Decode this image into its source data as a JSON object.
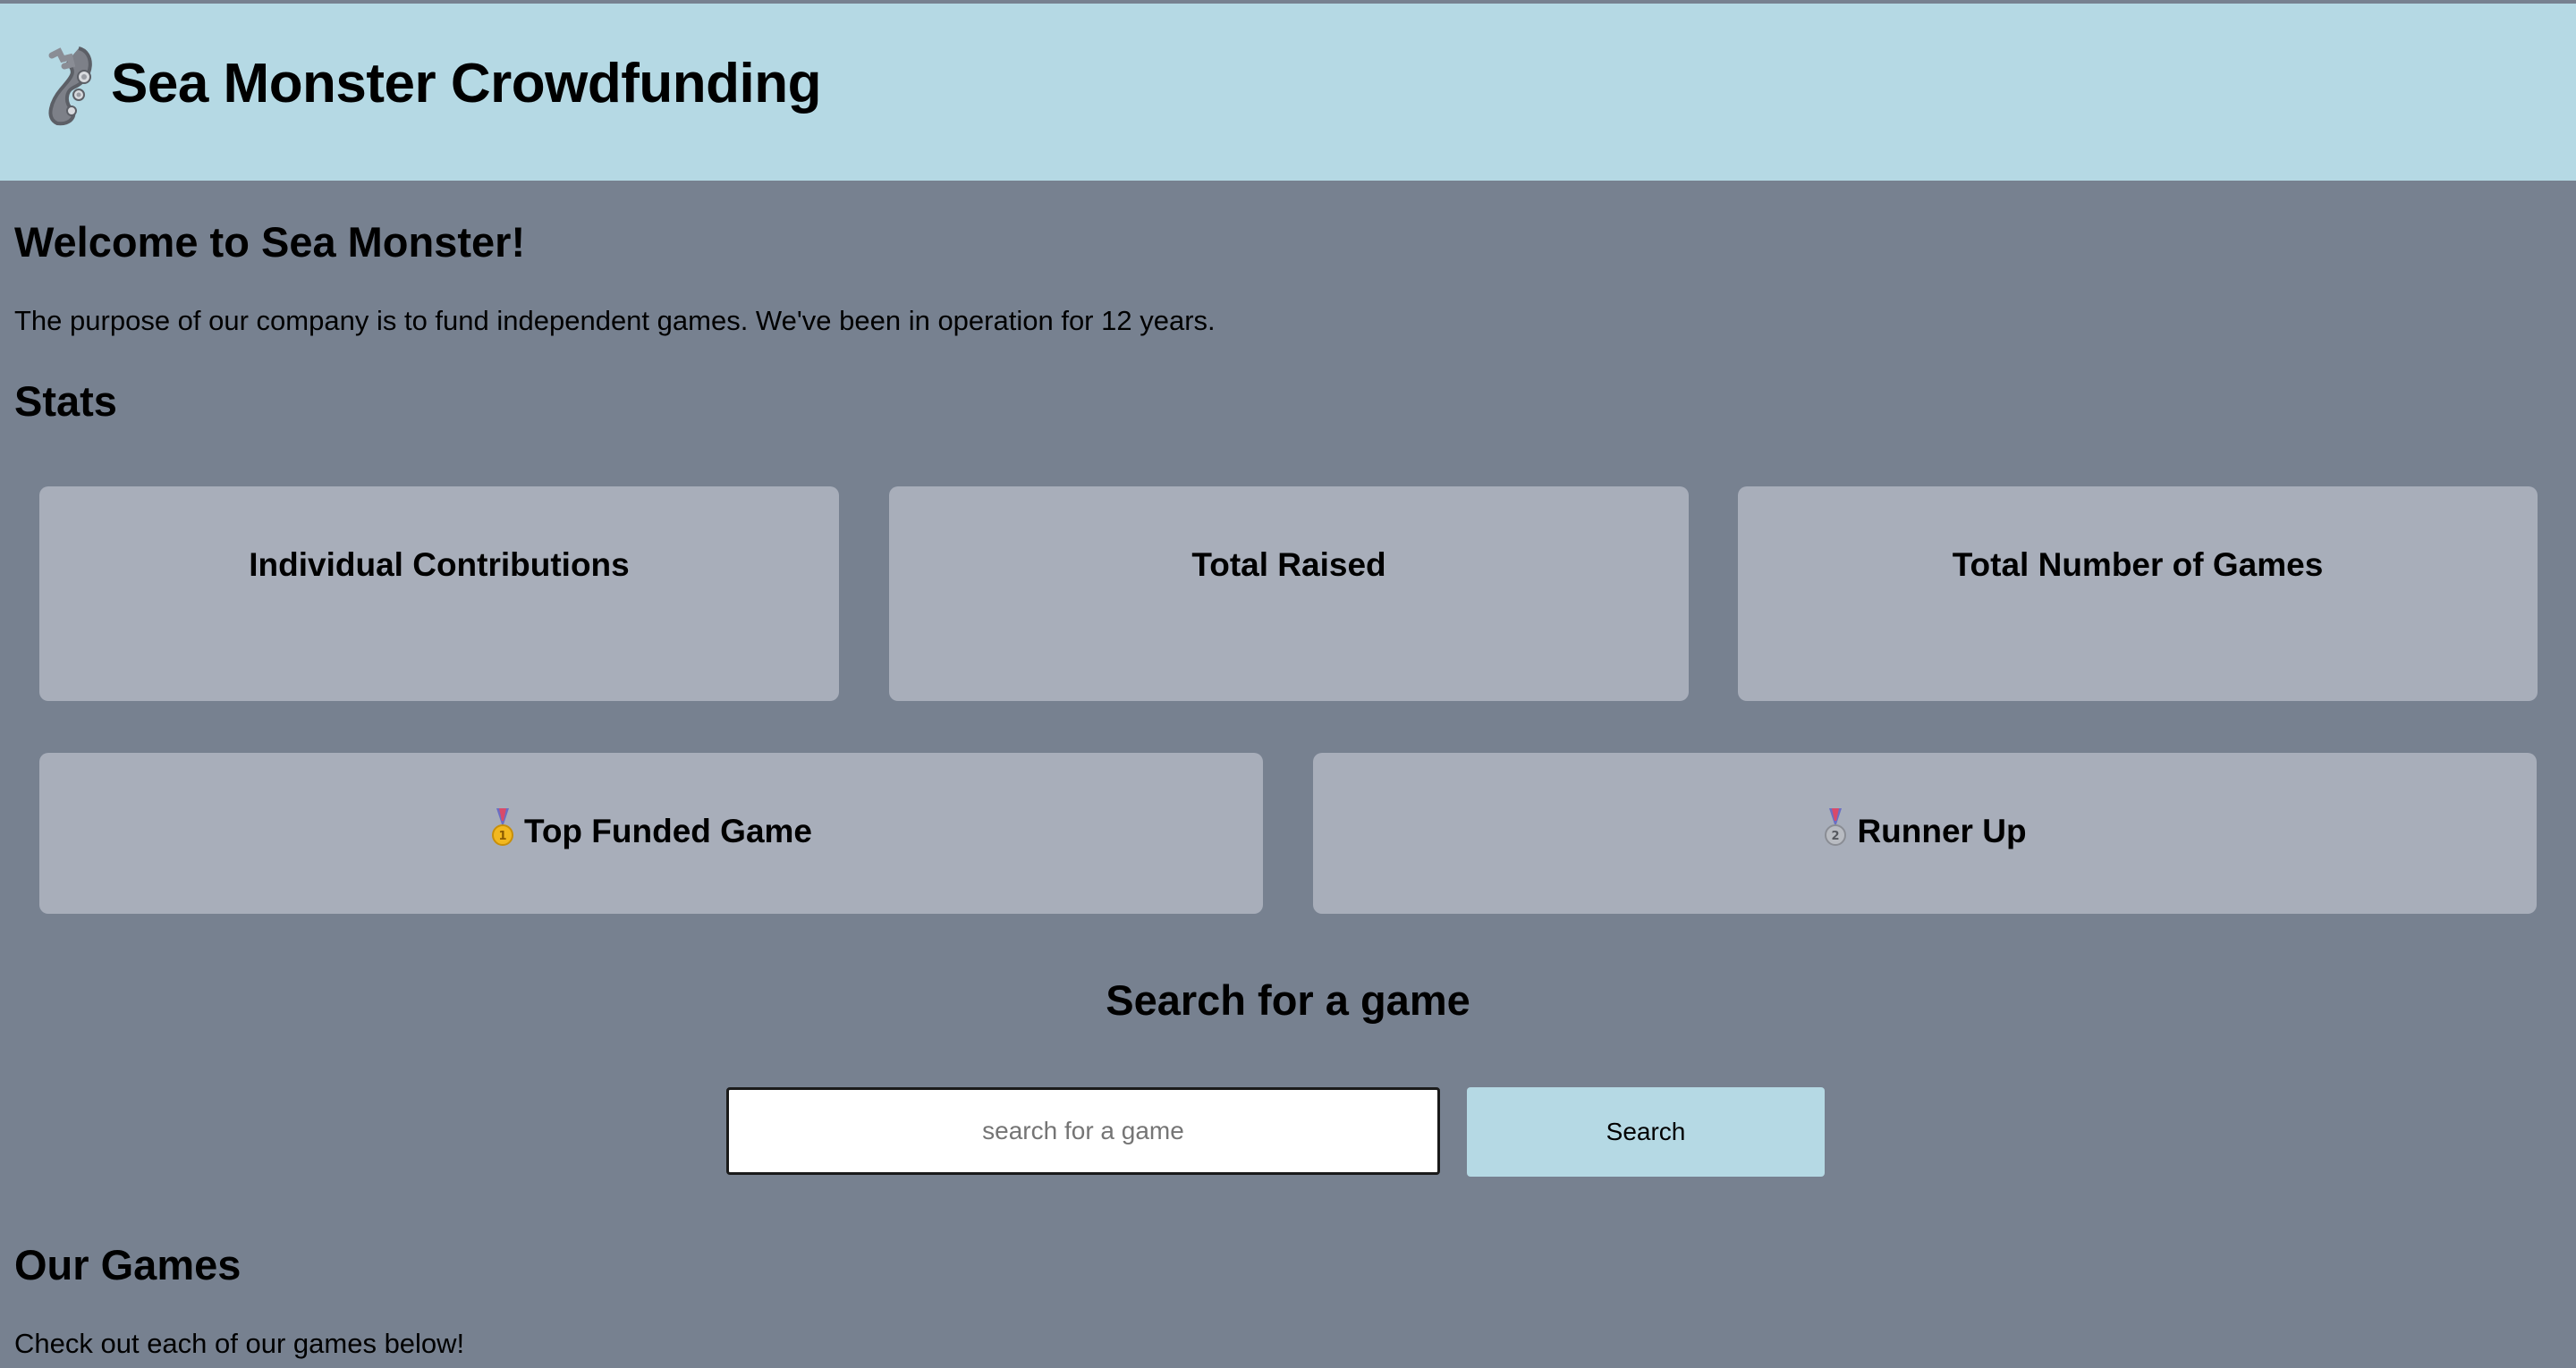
{
  "header": {
    "logo_icon": "sea-monster-tentacle-icon",
    "title": "Sea Monster Crowdfunding"
  },
  "welcome": {
    "heading": "Welcome to Sea Monster!",
    "text": "The purpose of our company is to fund independent games. We've been in operation for 12 years."
  },
  "stats": {
    "heading": "Stats",
    "cards": [
      {
        "title": "Individual Contributions"
      },
      {
        "title": "Total Raised"
      },
      {
        "title": "Total Number of Games"
      }
    ],
    "top_funded": {
      "title": "Top Funded Game",
      "icon": "gold-medal-icon"
    },
    "runner_up": {
      "title": "Runner Up",
      "icon": "silver-medal-icon"
    }
  },
  "search": {
    "heading": "Search for a game",
    "placeholder": "search for a game",
    "value": "",
    "button_label": "Search"
  },
  "games": {
    "heading": "Our Games",
    "text": "Check out each of our games below!"
  },
  "colors": {
    "background": "#778190",
    "header": "#b5d9e4",
    "card": "#a8aeba",
    "button": "#b5d9e4"
  }
}
